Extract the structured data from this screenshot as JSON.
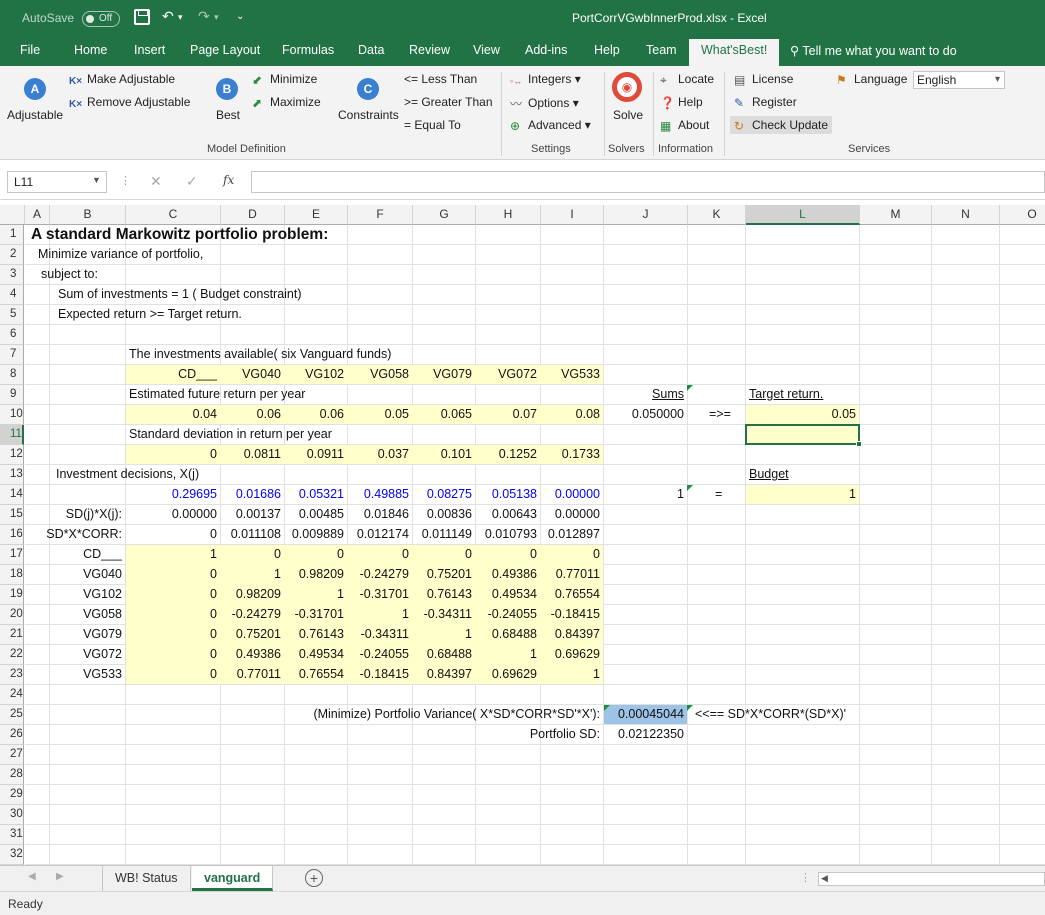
{
  "window": {
    "autosave_label": "AutoSave",
    "autosave_state": "Off",
    "document_title": "PortCorrVGwbInnerProd.xlsx  -  Excel"
  },
  "tabs": [
    "File",
    "Home",
    "Insert",
    "Page Layout",
    "Formulas",
    "Data",
    "Review",
    "View",
    "Add-ins",
    "Help",
    "Team",
    "What'sBest!"
  ],
  "tell_me": "Tell me what you want to do",
  "ribbon": {
    "adjustable": "Adjustable",
    "make_adjustable": "Make Adjustable",
    "remove_adjustable": "Remove Adjustable",
    "best": "Best",
    "minimize": "Minimize",
    "maximize": "Maximize",
    "constraints": "Constraints",
    "less_than": "<= Less Than",
    "greater_than": ">= Greater Than",
    "equal_to": "=  Equal To",
    "integers": "Integers",
    "options": "Options",
    "advanced": "Advanced",
    "solve": "Solve",
    "locate": "Locate",
    "help": "Help",
    "about": "About",
    "license": "License",
    "register": "Register",
    "check_update": "Check Update",
    "language_label": "Language",
    "language_value": "English",
    "groups": {
      "model_definition": "Model Definition",
      "settings": "Settings",
      "solvers": "Solvers",
      "information": "Information",
      "services": "Services"
    }
  },
  "formula_bar": {
    "name_box": "L11",
    "fx": "fx",
    "content": ""
  },
  "columns": [
    "A",
    "B",
    "C",
    "D",
    "E",
    "F",
    "G",
    "H",
    "I",
    "J",
    "K",
    "L",
    "M",
    "N",
    "O"
  ],
  "rows": [
    "1",
    "2",
    "3",
    "4",
    "5",
    "6",
    "7",
    "8",
    "9",
    "10",
    "11",
    "12",
    "13",
    "14",
    "15",
    "16",
    "17",
    "18",
    "19",
    "20",
    "21",
    "22",
    "23",
    "24",
    "25",
    "26",
    "27",
    "28",
    "29",
    "30",
    "31",
    "32"
  ],
  "sheet": {
    "title": "A standard Markowitz portfolio problem:",
    "r2": "Minimize variance of portfolio,",
    "r3": "subject to:",
    "r4": "Sum of investments = 1  ( Budget constraint)",
    "r5": "Expected return >= Target return.",
    "r7": "The investments available( six Vanguard funds)",
    "funds": [
      "CD___",
      "VG040",
      "VG102",
      "VG058",
      "VG079",
      "VG072",
      "VG533"
    ],
    "r9": "Estimated future return per year",
    "returns": [
      "0.04",
      "0.06",
      "0.06",
      "0.05",
      "0.065",
      "0.07",
      "0.08"
    ],
    "sums_label": "Sums",
    "sum_return": "0.050000",
    "gte": "=>=",
    "target_label": "Target return.",
    "target_value": "0.05",
    "r11": "Standard deviation in return per year",
    "stdevs": [
      "0",
      "0.0811",
      "0.0911",
      "0.037",
      "0.101",
      "0.1252",
      "0.1733"
    ],
    "r13": "Investment decisions, X(j)",
    "budget_label": "Budget",
    "decisions": [
      "0.29695",
      "0.01686",
      "0.05321",
      "0.49885",
      "0.08275",
      "0.05138",
      "0.00000"
    ],
    "sum_decisions": "1",
    "eq": "=",
    "budget_value": "1",
    "sdx_label": "SD(j)*X(j):",
    "sdx": [
      "0.00000",
      "0.00137",
      "0.00485",
      "0.01846",
      "0.00836",
      "0.00643",
      "0.00000"
    ],
    "sdxcorr_label": "SD*X*CORR:",
    "sdxcorr": [
      "0",
      "0.011108",
      "0.009889",
      "0.012174",
      "0.011149",
      "0.010793",
      "0.012897"
    ],
    "corr_rows": [
      {
        "name": "CD___",
        "vals": [
          "1",
          "0",
          "0",
          "0",
          "0",
          "0",
          "0"
        ]
      },
      {
        "name": "VG040",
        "vals": [
          "0",
          "1",
          "0.98209",
          "-0.24279",
          "0.75201",
          "0.49386",
          "0.77011"
        ]
      },
      {
        "name": "VG102",
        "vals": [
          "0",
          "0.98209",
          "1",
          "-0.31701",
          "0.76143",
          "0.49534",
          "0.76554"
        ]
      },
      {
        "name": "VG058",
        "vals": [
          "0",
          "-0.24279",
          "-0.31701",
          "1",
          "-0.34311",
          "-0.24055",
          "-0.18415"
        ]
      },
      {
        "name": "VG079",
        "vals": [
          "0",
          "0.75201",
          "0.76143",
          "-0.34311",
          "1",
          "0.68488",
          "0.84397"
        ]
      },
      {
        "name": "VG072",
        "vals": [
          "0",
          "0.49386",
          "0.49534",
          "-0.24055",
          "0.68488",
          "1",
          "0.69629"
        ]
      },
      {
        "name": "VG533",
        "vals": [
          "0",
          "0.77011",
          "0.76554",
          "-0.18415",
          "0.84397",
          "0.69629",
          "1"
        ]
      }
    ],
    "variance_label": "(Minimize) Portfolio Variance( X*SD*CORR*SD'*X'):",
    "variance_value": "0.00045044",
    "variance_note": "<<== SD*X*CORR*(SD*X)'",
    "sd_label": "Portfolio SD:",
    "sd_value": "0.02122350"
  },
  "sheet_tabs": [
    "WB! Status",
    "vanguard"
  ],
  "status": "Ready",
  "colors": {
    "accent": "#217346",
    "input_fill": "#ffffcc",
    "objective_fill": "#9dc3e6",
    "decision_text": "#0000ee"
  }
}
